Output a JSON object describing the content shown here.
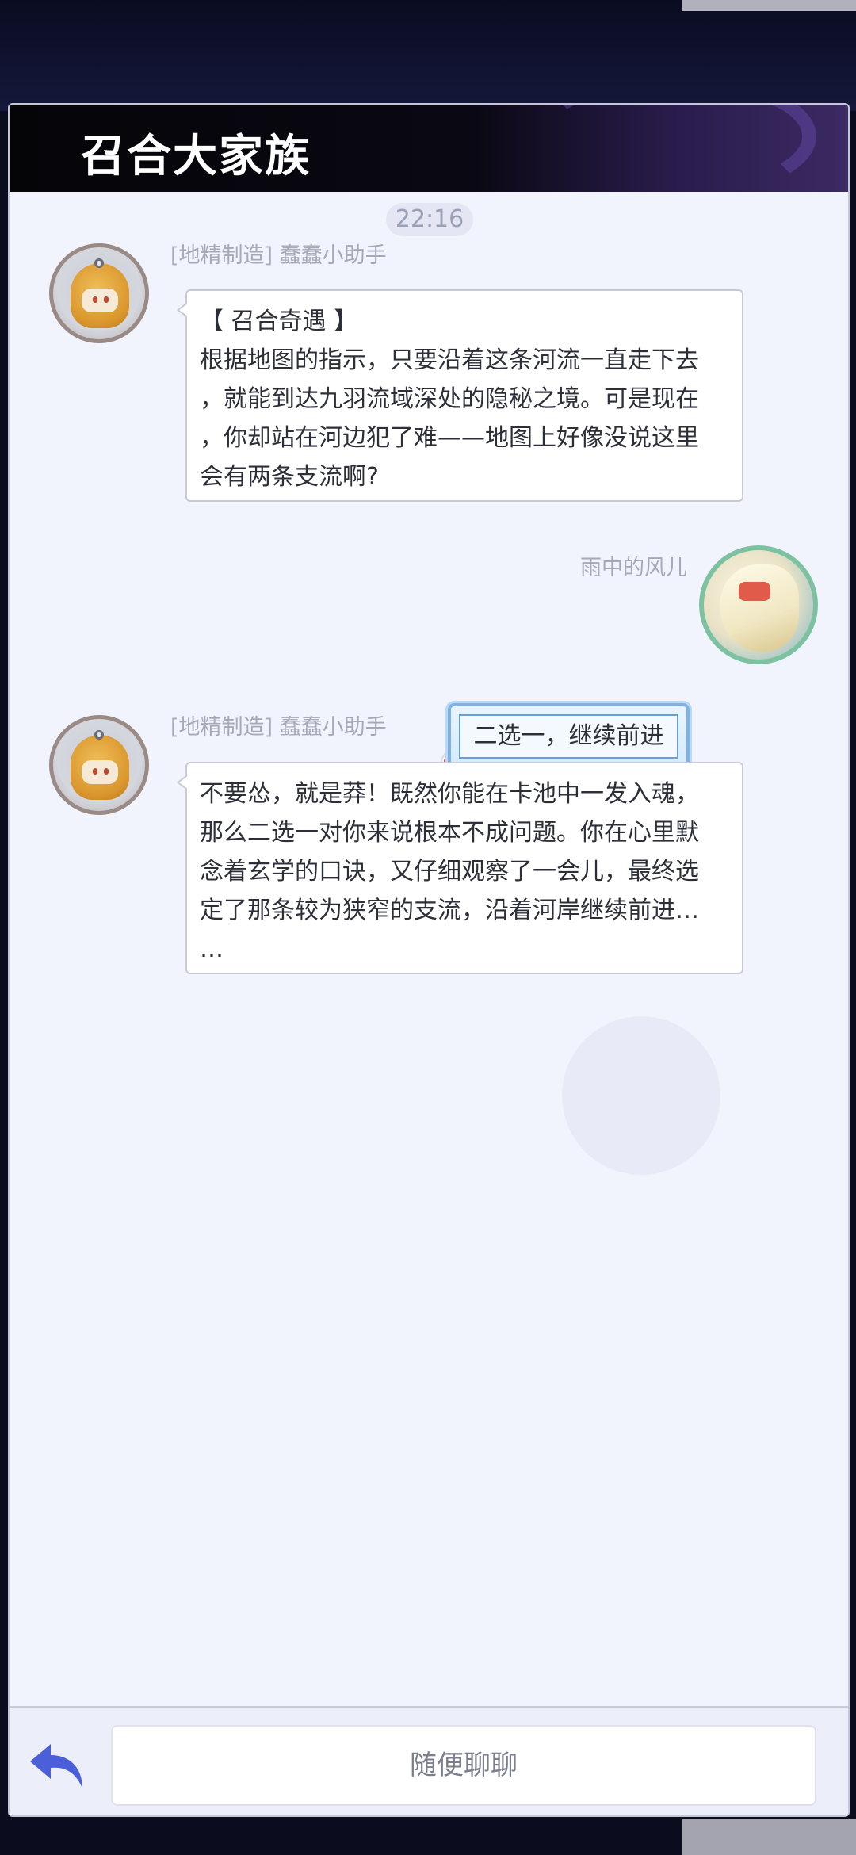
{
  "header": {
    "title": "召合大家族"
  },
  "timestamp": "22:16",
  "messages": [
    {
      "sender": "[地精制造] 蠢蠢小助手",
      "lines": [
        "【 召合奇遇 】",
        "根据地图的指示，只要沿着这条河流一直走下去",
        "，就能到达九羽流域深处的隐秘之境。可是现在",
        "，你却站在河边犯了难——地图上好像没说这里",
        "会有两条支流啊?"
      ]
    },
    {
      "sender": "雨中的风儿",
      "text": "二选一，继续前进"
    },
    {
      "sender": "[地精制造] 蠢蠢小助手",
      "lines": [
        "不要怂，就是莽！既然你能在卡池中一发入魂，",
        "那么二选一对你来说根本不成问题。你在心里默",
        "念着玄学的口诀，又仔细观察了一会儿，最终选",
        "定了那条较为狭窄的支流，沿着河岸继续前进…",
        "…"
      ]
    }
  ],
  "footer": {
    "input_placeholder": "随便聊聊"
  },
  "icons": {
    "back": "reply-arrow-icon",
    "bot_avatar": "robot-avatar-icon",
    "user_avatar": "character-avatar-icon"
  },
  "colors": {
    "panel_bg": "#f2f4fd",
    "header_bg": "#050508",
    "accent_back": "#4b5fd8",
    "name_text": "#a6a9b8"
  }
}
